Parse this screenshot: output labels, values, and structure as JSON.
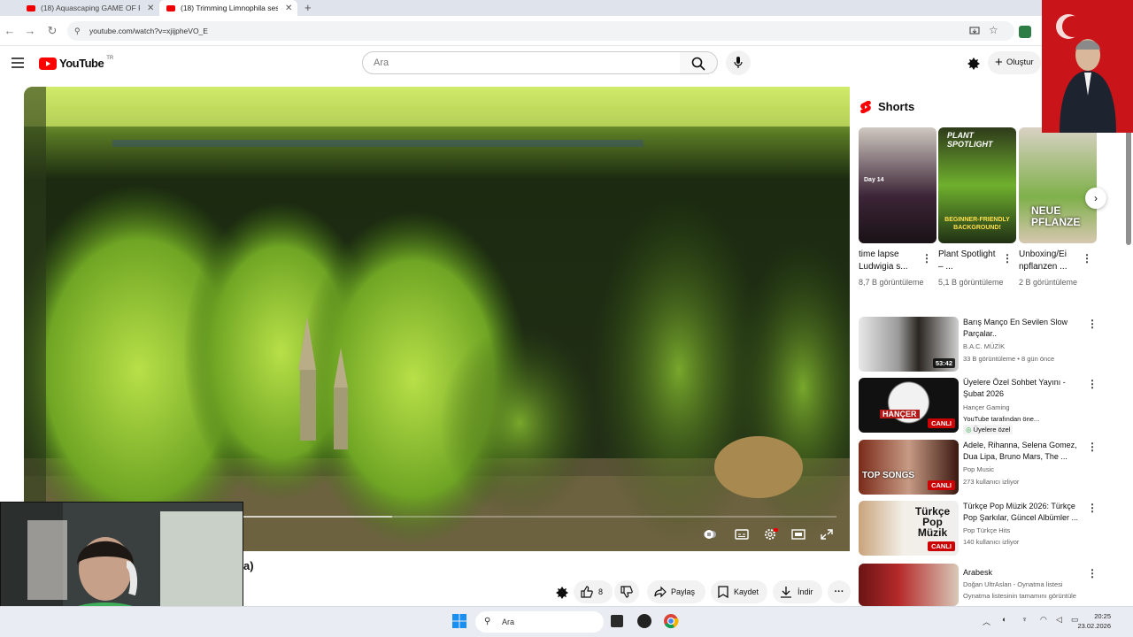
{
  "browser": {
    "tabs": [
      {
        "label": "(18) Aquascaping GAME OF Ri..."
      },
      {
        "label": "(18) Trimming Limnophila sessi..."
      }
    ],
    "url": "youtube.com/watch?v=xjijpheVO_E"
  },
  "youtube": {
    "logo": "YouTube",
    "country": "TR",
    "search_placeholder": "Ara",
    "create_label": "Oluştur"
  },
  "shorts": {
    "heading": "Shorts",
    "items": [
      {
        "title": "time lapse Ludwigia s...",
        "views": "8,7 B görüntüleme",
        "overlay": "Day 14"
      },
      {
        "title": "Plant Spotlight – ...",
        "views": "5,1 B görüntüleme",
        "overlay_top": "PLANT SPOTLIGHT",
        "overlay_bottom": "BEGINNER-FRIENDLY BACKGROUND!"
      },
      {
        "title": "Unboxing/Ei npflanzen ...",
        "views": "2 B görüntüleme",
        "overlay": "NEUE PFLANZE"
      }
    ]
  },
  "related": [
    {
      "title": "Barış Manço En Sevilen Slow Parçalar..",
      "channel": "B.A.C. MÜZİK",
      "meta": "33 B görüntüleme • 8 gün önce",
      "duration": "53:42"
    },
    {
      "title": "Üyelere Özel Sohbet Yayını - Şubat 2026",
      "channel": "Hançer Gaming",
      "meta": "YouTube tarafından öne...",
      "badge": "Üyelere özel",
      "live": "CANLI",
      "thumb_text": "HANÇER"
    },
    {
      "title": "Adele, Rihanna, Selena Gomez, Dua Lipa, Bruno Mars, The ...",
      "channel": "Pop Music",
      "meta": "273 kullanıcı izliyor",
      "live": "CANLI",
      "thumb_text": "TOP SONGS"
    },
    {
      "title": "Türkçe Pop Müzik 2026: Türkçe Pop Şarkılar, Güncel Albümler ...",
      "channel": "Pop Türkçe Hits",
      "meta": "140 kullanıcı izliyor",
      "live": "CANLI",
      "thumb_text": "Türkçe Pop Müzik"
    },
    {
      "title": "Arabesk",
      "channel": "Doğan UltrAslan - Oynatma listesi",
      "meta": "Oynatma listesinin tamamını görüntüle"
    }
  ],
  "actions": {
    "like_count": "8",
    "share": "Paylaş",
    "save": "Kaydet",
    "download": "İndir"
  },
  "video_title_fragment": "a)",
  "taskbar": {
    "search": "Ara",
    "time": "20:25",
    "date": "23.02.2026"
  },
  "colors": {
    "youtube_red": "#ff0000",
    "live_red": "#cc0000",
    "members_green": "#2ba640"
  }
}
